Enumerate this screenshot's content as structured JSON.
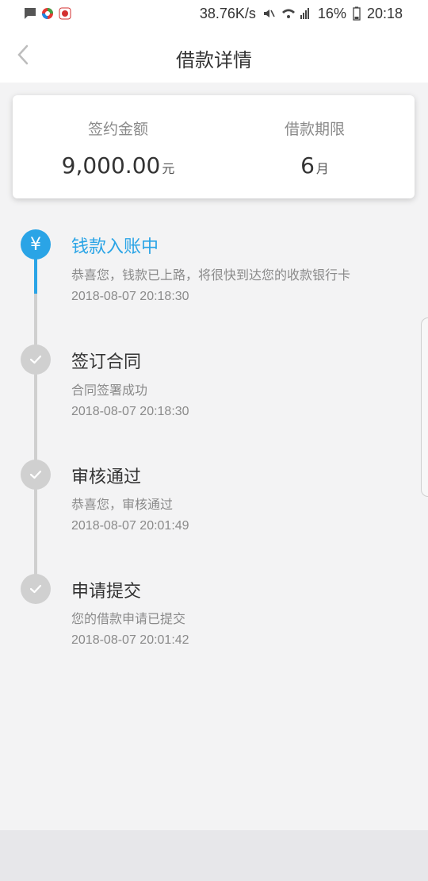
{
  "status_bar": {
    "speed": "38.76K/s",
    "battery": "16%",
    "time": "20:18"
  },
  "header": {
    "title": "借款详情"
  },
  "summary": {
    "amount_label": "签约金额",
    "amount_value": "9,000.00",
    "amount_unit": "元",
    "term_label": "借款期限",
    "term_value": "6",
    "term_unit": "月"
  },
  "timeline": [
    {
      "title": "钱款入账中",
      "desc": "恭喜您，钱款已上路，将很快到达您的收款银行卡",
      "time": "2018-08-07 20:18:30",
      "state": "current",
      "icon": "yen-icon"
    },
    {
      "title": "签订合同",
      "desc": "合同签署成功",
      "time": "2018-08-07 20:18:30",
      "state": "done",
      "icon": "check-icon"
    },
    {
      "title": "审核通过",
      "desc": "恭喜您，审核通过",
      "time": "2018-08-07 20:01:49",
      "state": "done",
      "icon": "check-icon"
    },
    {
      "title": "申请提交",
      "desc": "您的借款申请已提交",
      "time": "2018-08-07 20:01:42",
      "state": "done",
      "icon": "check-icon"
    }
  ],
  "colors": {
    "accent": "#2aa4e6",
    "done": "#d0d0d0",
    "background": "#f3f3f4"
  }
}
